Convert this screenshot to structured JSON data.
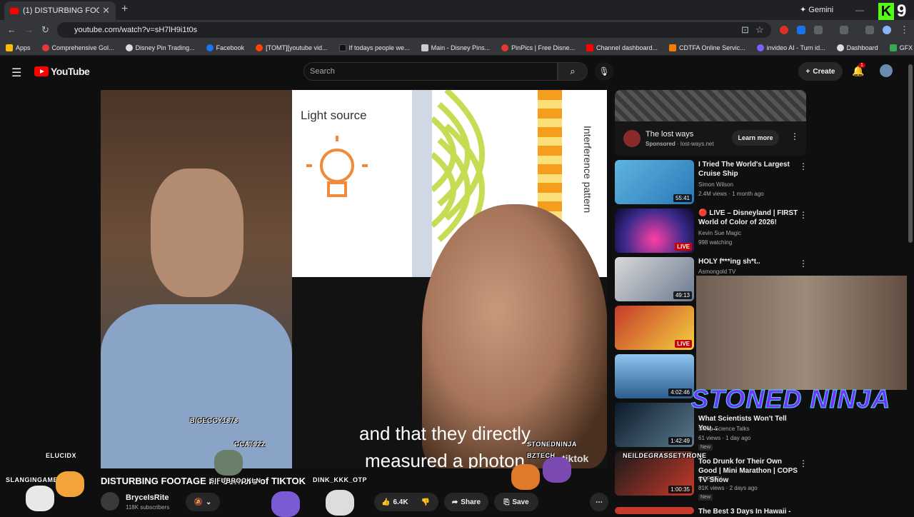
{
  "browser": {
    "tab_title": "(1) DISTURBING FOOTAGE",
    "new_tab": "+",
    "gemini_label": "Gemini",
    "kick_badge": "K",
    "kick_count": "9",
    "url": "youtube.com/watch?v=sH7lH9i1t0s",
    "bookmarks": [
      "Apps",
      "Comprehensive Gol...",
      "Disney Pin Trading...",
      "Facebook",
      "[TOMT][youtube vid...",
      "If todays people we...",
      "Main - Disney Pins...",
      "PinPics | Free Disne...",
      "Channel dashboard...",
      "CDTFA Online Servic...",
      "invideo AI - Turn id...",
      "Dashboard",
      "GFX - Google Drive"
    ]
  },
  "youtube": {
    "logo": "YouTube",
    "search_placeholder": "Search",
    "create_label": "Create",
    "notif_count": "1"
  },
  "player": {
    "slide_title": "Light source",
    "slide_side": "Interference pattern",
    "caption_line1": "and that they directly",
    "caption_line2": "measured a photon",
    "watermark": "tiktok"
  },
  "video": {
    "title": "DISTURBING FOOTAGE I... Corners of TIKTOK",
    "channel": "BryceIsRite",
    "subscribers": "118K subscribers",
    "likes": "6.4K",
    "share": "Share",
    "save": "Save"
  },
  "ad": {
    "title": "The lost ways",
    "sponsored": "Sponsored",
    "domain": "lost-ways.net",
    "button": "Learn more"
  },
  "sidebar": [
    {
      "title": "I Tried The World's Largest Cruise Ship",
      "channel": "Simon Wilson",
      "meta": "2.4M views · 1 month ago",
      "duration": "55:41"
    },
    {
      "title": "🔴 LIVE – Disneyland | FIRST World of Color of 2026!",
      "channel": "Kevin Sue Magic",
      "meta": "998 watching",
      "duration": "LIVE"
    },
    {
      "title": "HOLY f***ing sh*t..",
      "channel": "Asmongold TV",
      "meta": "",
      "duration": "49:13"
    },
    {
      "title": "",
      "channel": "",
      "meta": "",
      "duration": "LIVE"
    },
    {
      "title": "",
      "channel": "",
      "meta": "",
      "duration": "4:02:46"
    },
    {
      "title": "What Scientists Won't Tell You...",
      "channel": "Sleep Science Talks",
      "meta": "61 views · 1 day ago",
      "duration": "1:42:49",
      "badge": "New"
    },
    {
      "title": "Too Drunk for Their Own Good | Mini Marathon | COPS TV Show",
      "channel": "COPSTV",
      "meta": "81K views · 2 days ago",
      "duration": "1:00:35",
      "badge": "New"
    },
    {
      "title": "The Best 3 Days In Hawaii -",
      "channel": "",
      "meta": "",
      "duration": ""
    }
  ],
  "overlay": {
    "brand": "STONED NINJA",
    "chatters": [
      "BIGEGGY1878",
      "GCAT922",
      "ELUCIDX",
      "SLANGINGAMES",
      "SIFUBROOKLN",
      "STONEDNINJA",
      "BZTECH",
      "NEILDEGRASSETYRONE",
      "DINK_KKK_OTP"
    ]
  }
}
